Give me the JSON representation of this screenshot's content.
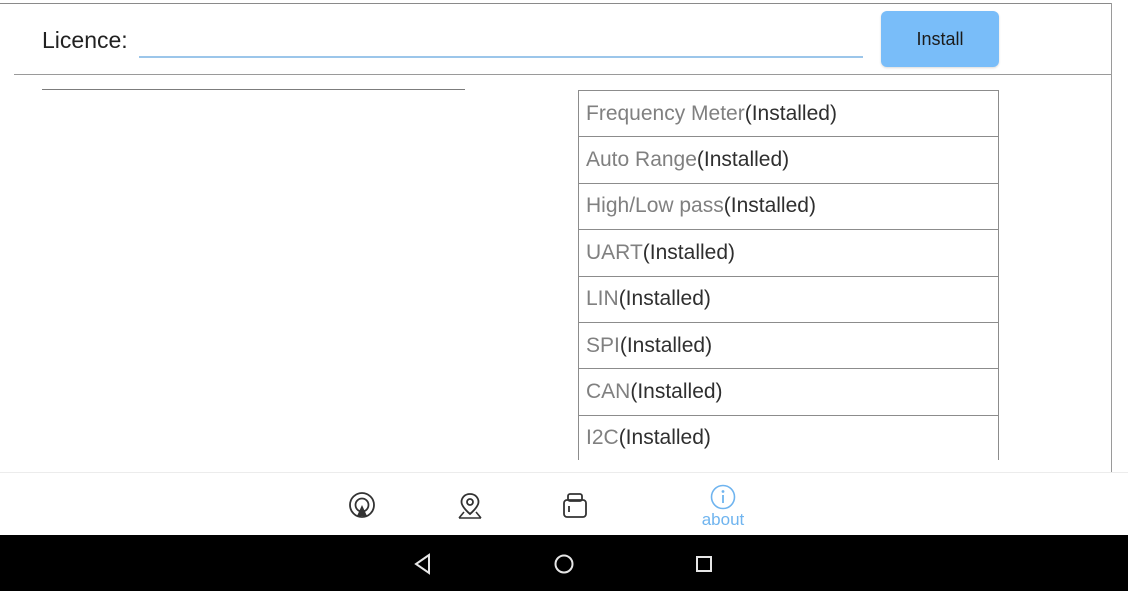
{
  "header": {
    "licence_label": "Licence:",
    "licence_value": "",
    "install_label": "Install"
  },
  "modules": [
    {
      "name": "Frequency Meter",
      "status": "(Installed)"
    },
    {
      "name": "Auto Range",
      "status": "(Installed)"
    },
    {
      "name": "High/Low pass",
      "status": "(Installed)"
    },
    {
      "name": "UART",
      "status": "(Installed)"
    },
    {
      "name": "LIN",
      "status": "(Installed)"
    },
    {
      "name": "SPI",
      "status": "(Installed)"
    },
    {
      "name": "CAN",
      "status": "(Installed)"
    },
    {
      "name": "I2C",
      "status": "(Installed)"
    }
  ],
  "nav": {
    "items": [
      {
        "icon": "oscilloscope-icon",
        "label": ""
      },
      {
        "icon": "location-pin-icon",
        "label": ""
      },
      {
        "icon": "device-icon",
        "label": ""
      },
      {
        "icon": "info-icon",
        "label": "about",
        "active": true
      }
    ],
    "active_color": "#6fb4ef"
  },
  "system_bar": {
    "buttons": [
      "back-icon",
      "home-icon",
      "recents-icon"
    ]
  },
  "colors": {
    "install_button": "#79bdf9",
    "input_underline": "#9cc6ea"
  }
}
